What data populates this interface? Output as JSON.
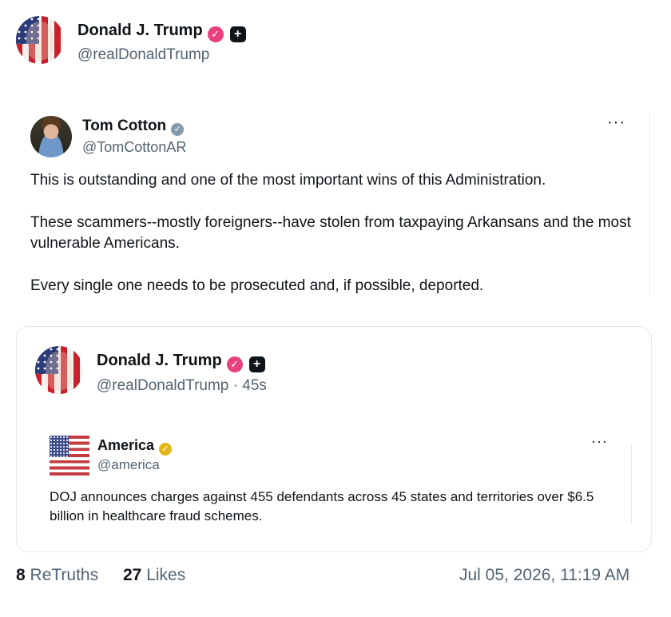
{
  "post": {
    "author_name": "Donald J. Trump",
    "author_handle": "@realDonaldTrump"
  },
  "quoted": {
    "author_name": "Tom Cotton",
    "author_handle": "@TomCottonAR",
    "paragraphs": [
      "This is outstanding and one of the most important wins of this Administration.",
      "These scammers--mostly foreigners--have stolen from taxpaying Arkansans and the most vulnerable Americans.",
      "Every single one needs to be prosecuted and, if possible, deported."
    ]
  },
  "embedded": {
    "author_name": "Donald J. Trump",
    "author_handle": "@realDonaldTrump",
    "time": "· 45s",
    "inner": {
      "author_name": "America",
      "author_handle": "@america",
      "text": "DOJ announces charges against 455 defendants across 45 states and territories over $6.5 billion in healthcare fraud schemes."
    }
  },
  "footer": {
    "retruths_count": "8",
    "retruths_label": "ReTruths",
    "likes_count": "27",
    "likes_label": "Likes",
    "timestamp": "Jul 05, 2026, 11:19 AM"
  },
  "icons": {
    "verified_pink": "verified-badge-pink",
    "verified_grey": "verified-badge-grey",
    "verified_gold": "verified-badge-gold",
    "plus": "plus-square-icon",
    "more": "more-horizontal-icon"
  },
  "colors": {
    "text": "#0f1419",
    "muted": "#536471",
    "badge_pink": "#e8417e",
    "badge_gold": "#e2b719",
    "border": "#e5e8eb"
  }
}
